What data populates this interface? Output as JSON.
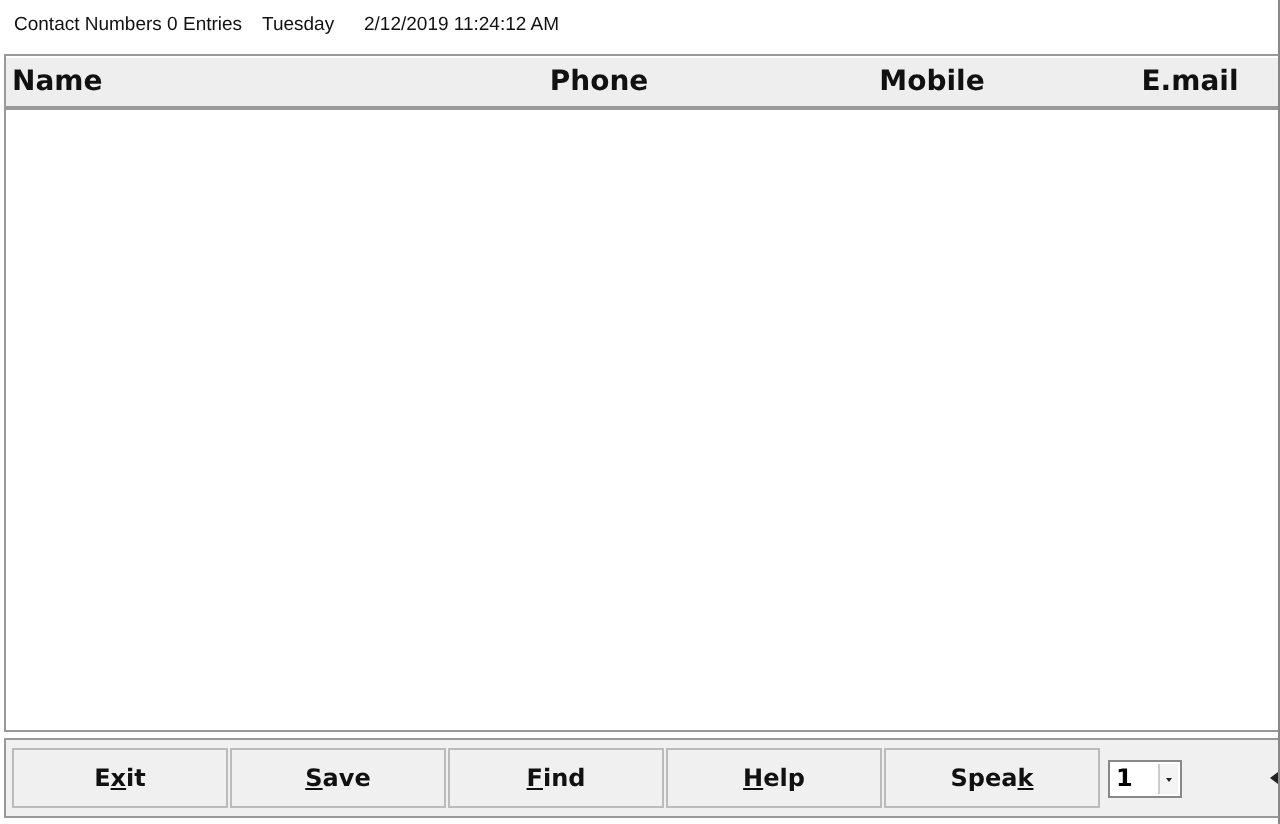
{
  "status_bar": {
    "title": "Contact Numbers 0 Entries",
    "day": "Tuesday",
    "datetime": "2/12/2019  11:24:12 AM"
  },
  "table": {
    "columns": [
      "Name",
      "Phone",
      "Mobile",
      "E.mail"
    ]
  },
  "buttons": [
    {
      "before": "E",
      "key": "x",
      "after": "it"
    },
    {
      "key": "S",
      "after": "ave"
    },
    {
      "key": "F",
      "after": "ind"
    },
    {
      "key": "H",
      "after": "elp"
    },
    {
      "before": "Spea",
      "key": "k"
    }
  ],
  "voice_select": {
    "value": "1"
  }
}
